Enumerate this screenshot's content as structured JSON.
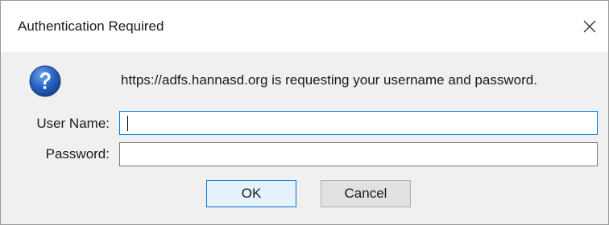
{
  "window": {
    "title": "Authentication Required",
    "close_icon": "close-icon"
  },
  "prompt": {
    "icon": "question-icon",
    "message": "https://adfs.hannasd.org is requesting your username and password."
  },
  "form": {
    "username_label": "User Name:",
    "username_value": "",
    "password_label": "Password:",
    "password_value": ""
  },
  "buttons": {
    "ok_label": "OK",
    "cancel_label": "Cancel"
  },
  "colors": {
    "focus_border": "#0078d7",
    "default_button_bg": "#e5f1fb",
    "dialog_bg": "#f0f0f0",
    "titlebar_bg": "#ffffff",
    "icon_blue": "#1f5fb8"
  }
}
